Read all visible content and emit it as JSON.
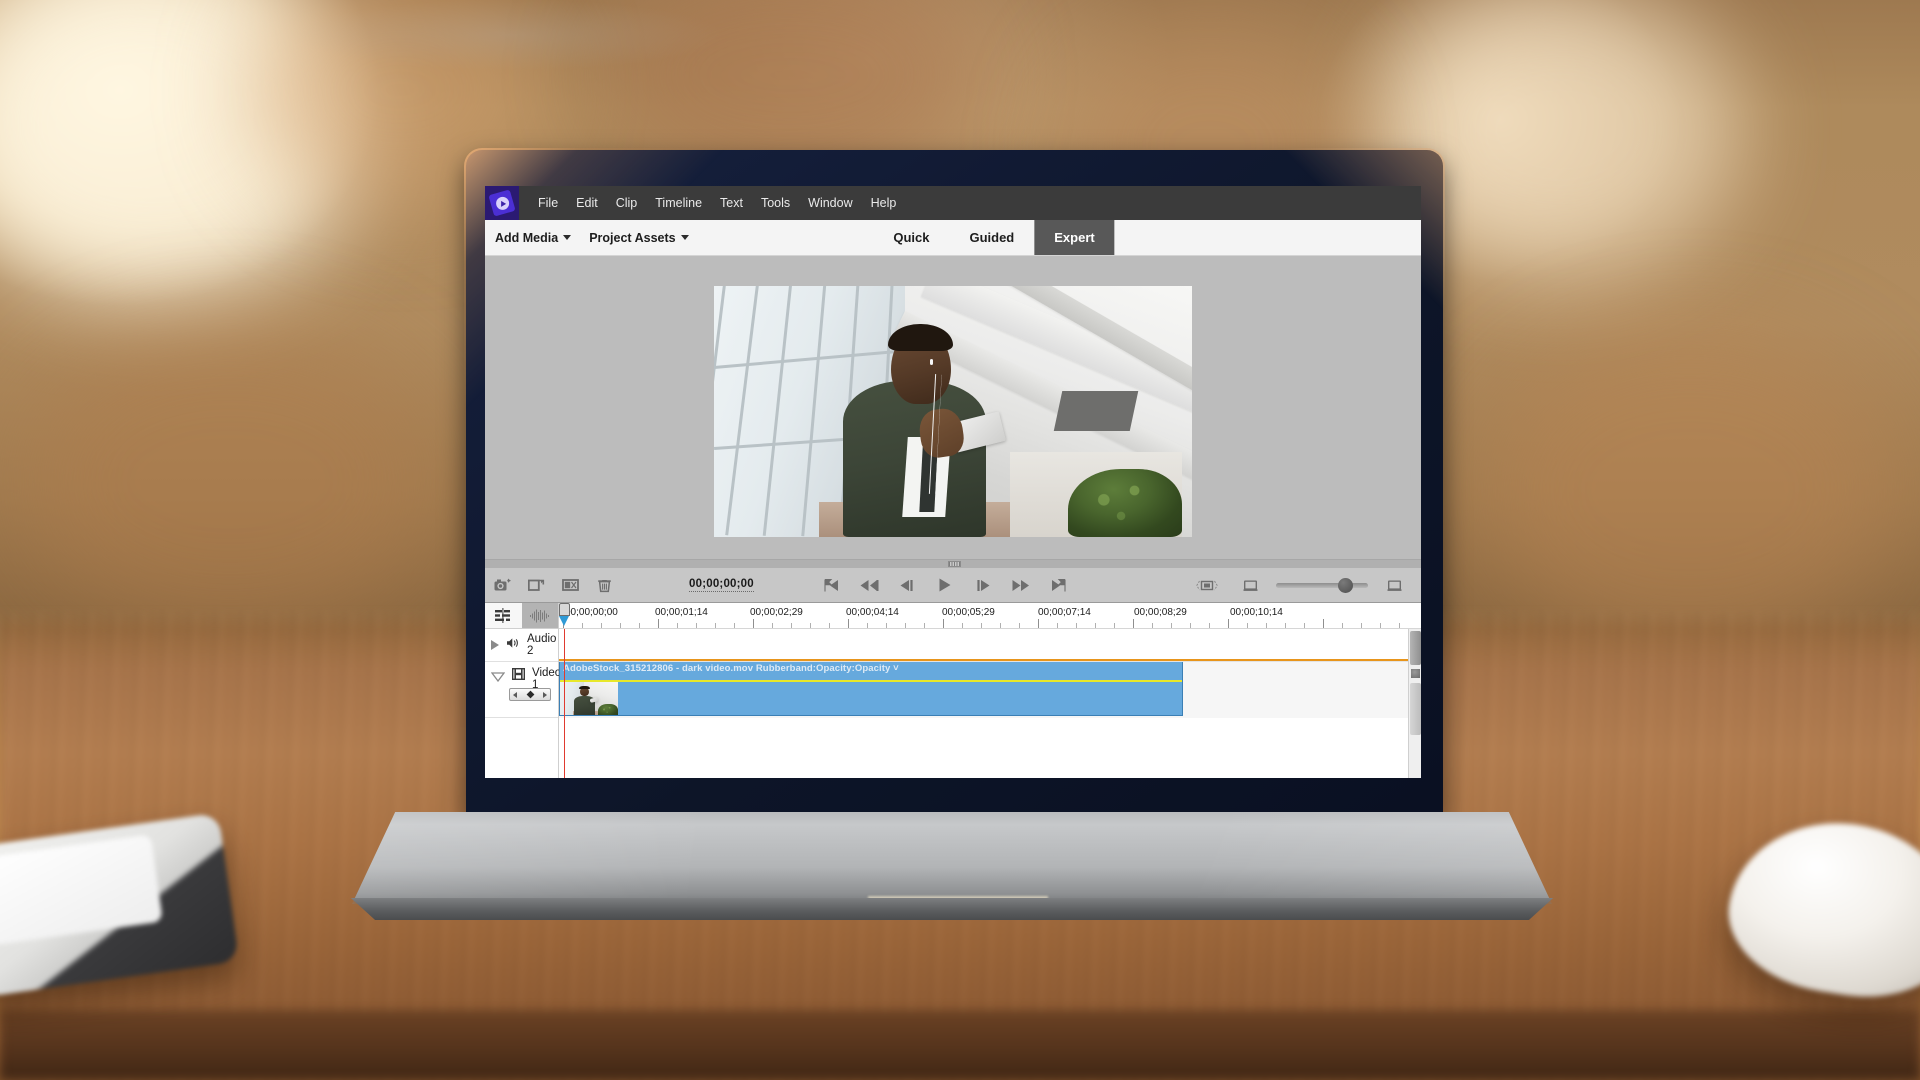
{
  "app": {
    "name": "Adobe Premiere Elements",
    "logo_icon": "premiere-elements-logo-icon"
  },
  "menubar": {
    "items": [
      {
        "label": "File"
      },
      {
        "label": "Edit"
      },
      {
        "label": "Clip"
      },
      {
        "label": "Timeline"
      },
      {
        "label": "Text"
      },
      {
        "label": "Tools"
      },
      {
        "label": "Window"
      },
      {
        "label": "Help"
      }
    ]
  },
  "toolbar": {
    "add_media_label": "Add Media",
    "project_assets_label": "Project Assets",
    "modes": [
      {
        "label": "Quick",
        "active": false
      },
      {
        "label": "Guided",
        "active": false
      },
      {
        "label": "Expert",
        "active": true
      }
    ]
  },
  "monitor": {
    "preview_alt": "video-preview-frame"
  },
  "transport": {
    "timecode": "00;00;00;00",
    "tools": [
      {
        "name": "freeze-frame-icon"
      },
      {
        "name": "pan-zoom-icon"
      },
      {
        "name": "smart-trim-icon"
      },
      {
        "name": "delete-icon"
      }
    ],
    "playback": [
      {
        "name": "go-to-in-point-icon"
      },
      {
        "name": "step-back-fast-icon"
      },
      {
        "name": "step-back-frame-icon"
      },
      {
        "name": "play-icon"
      },
      {
        "name": "step-forward-frame-icon"
      },
      {
        "name": "step-forward-fast-icon"
      },
      {
        "name": "go-to-out-point-icon"
      }
    ],
    "right_controls": [
      {
        "name": "safe-margins-icon"
      },
      {
        "name": "monitor-size-icon"
      },
      {
        "name": "zoom-slider"
      },
      {
        "name": "fullscreen-icon"
      }
    ],
    "zoom_slider_value": 68
  },
  "timeline": {
    "tools": [
      {
        "name": "timeline-settings-icon",
        "selected": false
      },
      {
        "name": "audio-waveform-icon",
        "selected": true
      }
    ],
    "ruler_labels": [
      "00;00;00;00",
      "00;00;01;14",
      "00;00;02;29",
      "00;00;04;14",
      "00;00;05;29",
      "00;00;07;14",
      "00;00;08;29",
      "00;00;10;14"
    ],
    "tracks": [
      {
        "name": "Audio 2",
        "type": "audio",
        "expanded": false,
        "disclosure_icon": "triangle-right-icon",
        "track_icon": "speaker-icon"
      },
      {
        "name": "Video 1",
        "type": "video",
        "expanded": true,
        "disclosure_icon": "triangle-down-icon",
        "track_icon": "filmstrip-icon",
        "navpad": {
          "prev_icon": "nav-prev-icon",
          "keyframe_icon": "keyframe-diamond-icon",
          "next_icon": "nav-next-icon"
        }
      }
    ],
    "clip": {
      "label": "AdobeStock_315212806 - dark video.mov Rubberband:Opacity:Opacity ˅",
      "fill_color": "#66a9dd",
      "rubberband_color": "#e8e82a"
    },
    "playhead_position_label": "00;00;00;00"
  },
  "colors": {
    "menubar_bg": "#3b3b3b",
    "toolbar_bg": "#f4f4f4",
    "active_mode_bg": "#585858",
    "monitor_bg": "#bcbcbc",
    "transport_bg": "#c7c7c7",
    "clip_blue": "#66a9dd",
    "cti_red": "#e03a2f",
    "logo_purple": "#2b1a72"
  }
}
